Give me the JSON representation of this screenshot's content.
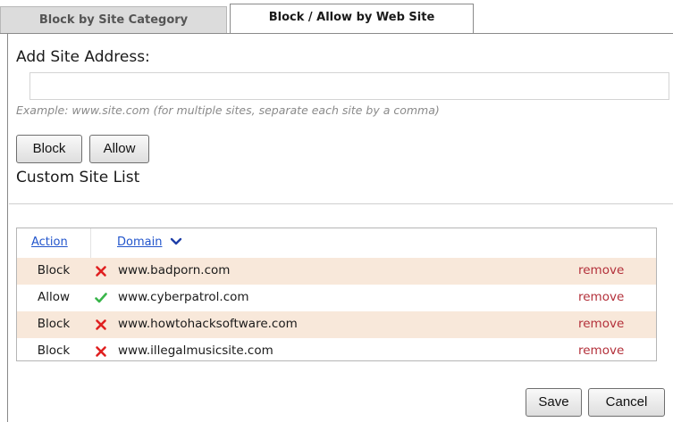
{
  "tabs": [
    {
      "label": "Block by Site Category",
      "active": false
    },
    {
      "label": "Block / Allow by Web Site",
      "active": true
    }
  ],
  "add_site": {
    "label": "Add Site Address:",
    "value": "",
    "placeholder": "",
    "example": "Example: www.site.com (for multiple sites, separate each site by a comma)"
  },
  "buttons": {
    "block": "Block",
    "allow": "Allow",
    "save": "Save",
    "cancel": "Cancel"
  },
  "custom_list": {
    "title": "Custom Site List",
    "columns": {
      "action": "Action",
      "domain": "Domain"
    },
    "sort_column": "Domain",
    "sort_icon": "chevron-down-icon",
    "rows": [
      {
        "action": "Block",
        "icon": "x-icon",
        "domain": "www.badporn.com",
        "remove": "remove"
      },
      {
        "action": "Allow",
        "icon": "check-icon",
        "domain": "www.cyberpatrol.com",
        "remove": "remove"
      },
      {
        "action": "Block",
        "icon": "x-icon",
        "domain": "www.howtohacksoftware.com",
        "remove": "remove"
      },
      {
        "action": "Block",
        "icon": "x-icon",
        "domain": "www.illegalmusicsite.com",
        "remove": "remove"
      }
    ]
  },
  "colors": {
    "block_icon": "#e02020",
    "allow_icon": "#39b54a",
    "remove_link": "#b3303a",
    "link": "#2255cc",
    "row_shade": "#f8e8da"
  }
}
